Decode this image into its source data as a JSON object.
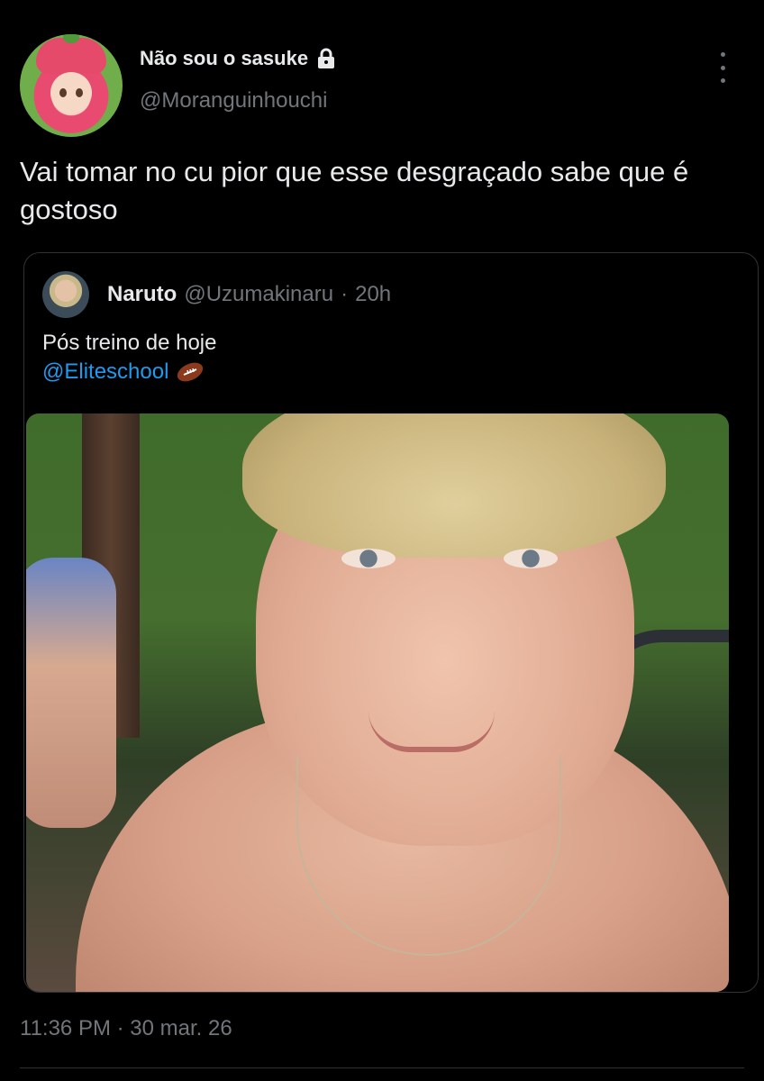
{
  "author": {
    "display_name": "Não sou o sasuke",
    "handle": "@Moranguinhouchi",
    "protected_icon": "lock-icon",
    "avatar": "strawberry-shortcake-avatar"
  },
  "tweet": {
    "text": "Vai tomar no cu pior que esse desgraçado sabe que é gostoso",
    "time": "11:36 PM",
    "separator": "·",
    "date": "30 mar. 26"
  },
  "menu": {
    "icon": "more-vertical-icon"
  },
  "quoted": {
    "display_name": "Naruto",
    "handle": "@Uzumakinaru",
    "separator": "·",
    "time_ago": "20h",
    "text": "Pós treino de hoje",
    "mention": "@Eliteschool",
    "emoji_icon": "american-football-icon",
    "image": "selfie-photo"
  },
  "colors": {
    "background": "#000000",
    "text": "#e7e9ea",
    "secondary_text": "#71767b",
    "link": "#1d9bf0",
    "border": "#2f3336"
  }
}
